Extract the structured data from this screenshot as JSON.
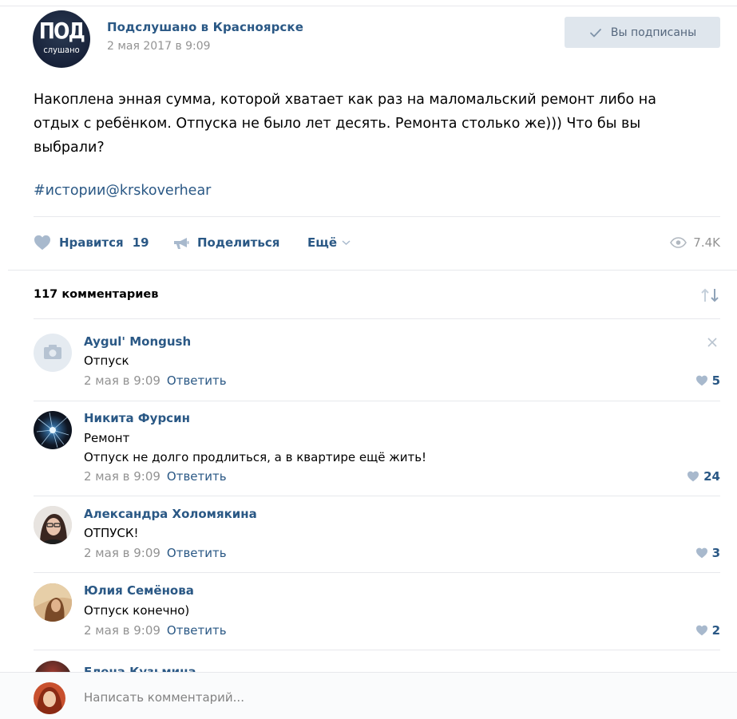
{
  "post": {
    "group_name": "Подслушано в Красноярске",
    "avatar_text_top": "ПОД",
    "avatar_text_bottom": "слушано",
    "date": "2 мая 2017 в 9:09",
    "subscribe_label": "Вы подписаны",
    "text_line1": "Накоплена энная сумма, которой хватает как раз на маломальский ремонт либо на",
    "text_line2": "отдых с ребёнком. Отпуска не было лет десять. Ремонта столько же))) Что бы вы",
    "text_line3": "выбрали?",
    "hashtag": "#истории@krskoverhear",
    "like_label": "Нравится",
    "like_count": "19",
    "share_label": "Поделиться",
    "more_label": "Ещё",
    "views": "7.4K"
  },
  "comments_header": {
    "count_label": "117 комментариев"
  },
  "comments": [
    {
      "author": "Aygul' Mongush",
      "text": "Отпуск",
      "date": "2 мая в 9:09",
      "reply": "Ответить",
      "likes": "5"
    },
    {
      "author": "Никита Фурсин",
      "text": "Ремонт",
      "text2": "Отпуск не долго продлиться, а в квартире ещё жить!",
      "date": "2 мая в 9:09",
      "reply": "Ответить",
      "likes": "24"
    },
    {
      "author": "Александра Холомякина",
      "text": "ОТПУСК!",
      "date": "2 мая в 9:09",
      "reply": "Ответить",
      "likes": "3"
    },
    {
      "author": "Юлия Семёнова",
      "text": "Отпуск конечно)",
      "date": "2 мая в 9:09",
      "reply": "Ответить",
      "likes": "2"
    },
    {
      "author": "Елена Кузьмина"
    }
  ],
  "compose": {
    "placeholder": "Написать комментарий..."
  },
  "colors": {
    "link": "#2a5885",
    "muted": "#939393",
    "divider": "#e7e8ec",
    "button_bg": "#dfe6ed"
  }
}
